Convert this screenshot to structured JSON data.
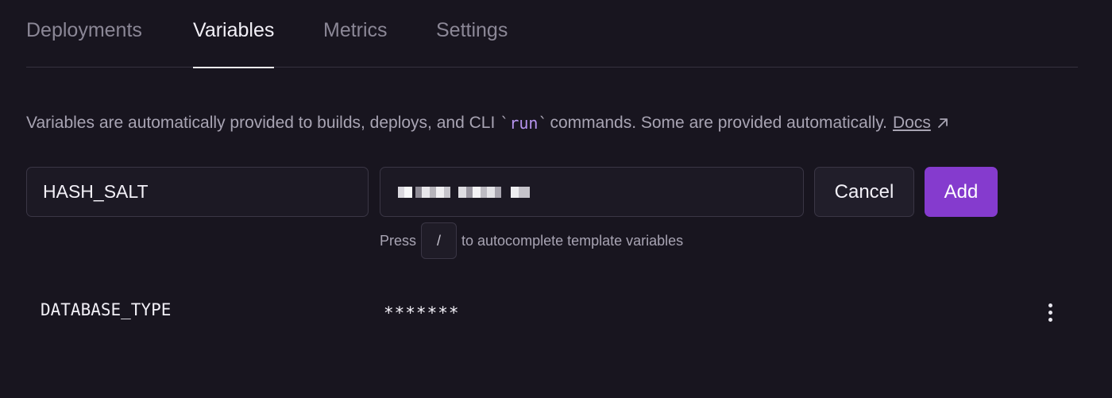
{
  "tabs": [
    {
      "label": "Deployments",
      "active": false
    },
    {
      "label": "Variables",
      "active": true
    },
    {
      "label": "Metrics",
      "active": false
    },
    {
      "label": "Settings",
      "active": false
    }
  ],
  "description": {
    "before": "Variables are automatically provided to builds, deploys, and CLI",
    "code": "run",
    "after": "commands. Some are provided automatically.",
    "docs_label": "Docs"
  },
  "form": {
    "key_value": "HASH_SALT",
    "cancel_label": "Cancel",
    "add_label": "Add"
  },
  "hint": {
    "before": "Press",
    "key": "/",
    "after": "to autocomplete template variables"
  },
  "variables": [
    {
      "name": "DATABASE_TYPE",
      "value": "*******"
    }
  ],
  "colors": {
    "background": "#18151f",
    "accent": "#853bce",
    "code": "#b694ee"
  }
}
